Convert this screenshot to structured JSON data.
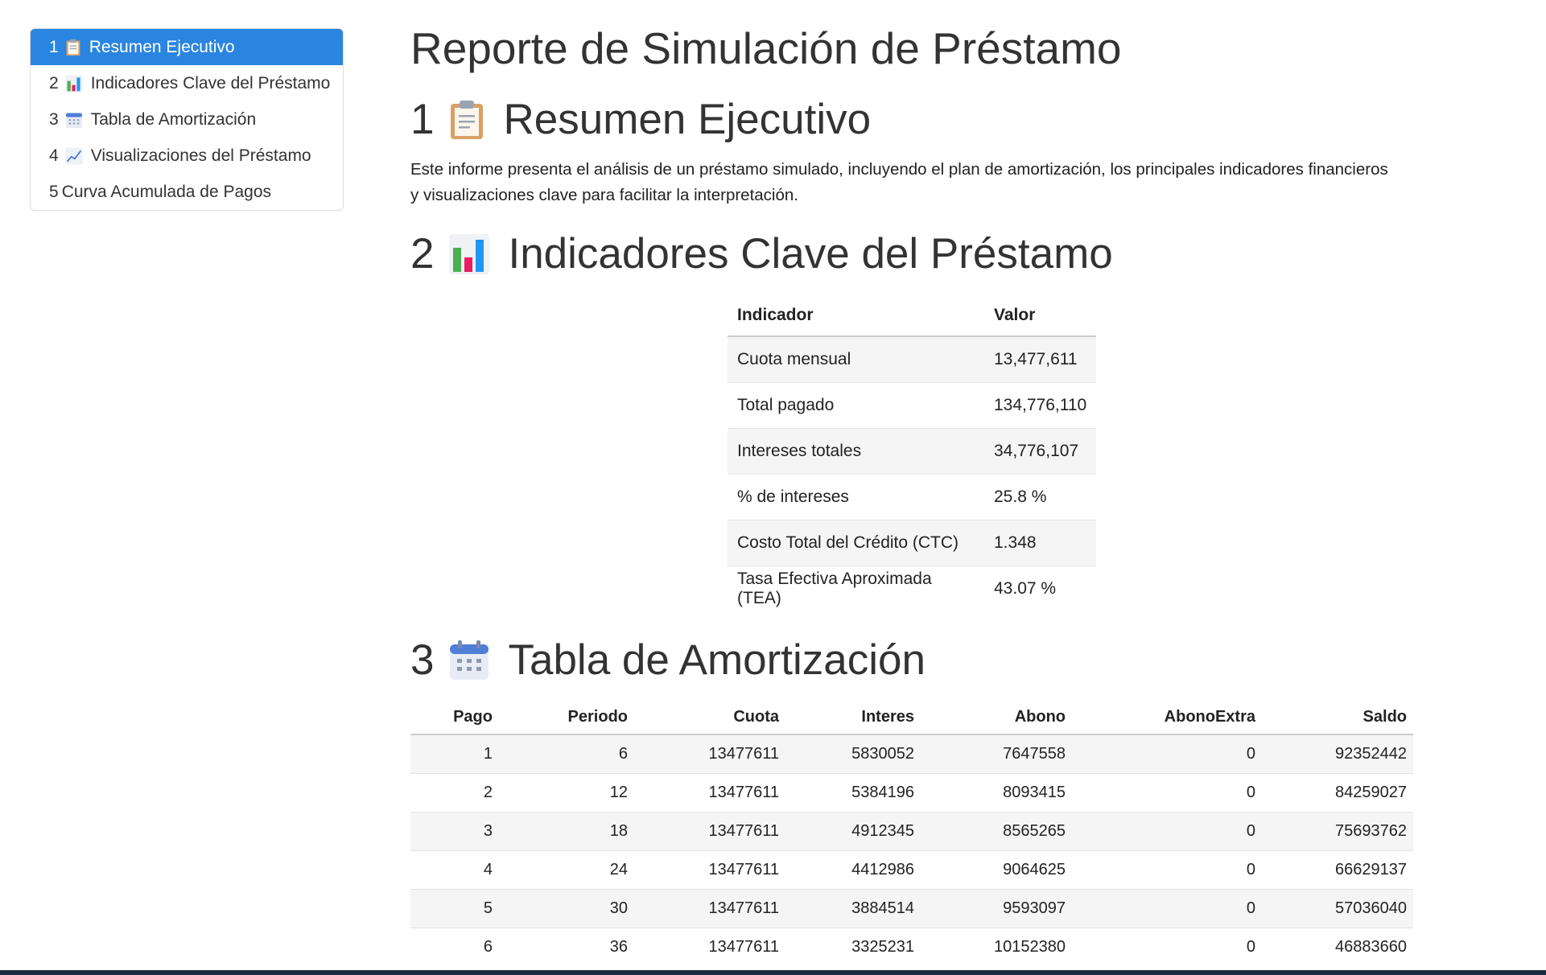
{
  "toc": [
    {
      "num": "1",
      "icon": "clipboard-icon",
      "label": "Resumen Ejecutivo",
      "active": true
    },
    {
      "num": "2",
      "icon": "bar-chart-icon",
      "label": "Indicadores Clave del Préstamo"
    },
    {
      "num": "3",
      "icon": "calendar-icon",
      "label": "Tabla de Amortización"
    },
    {
      "num": "4",
      "icon": "line-chart-icon",
      "label": "Visualizaciones del Préstamo"
    },
    {
      "num": "5",
      "icon": "",
      "label": "Curva Acumulada de Pagos"
    }
  ],
  "title": "Reporte de Simulación de Préstamo",
  "sections": {
    "s1": {
      "num": "1",
      "icon": "clipboard-icon",
      "title": "Resumen Ejecutivo"
    },
    "s2": {
      "num": "2",
      "icon": "bar-chart-icon",
      "title": "Indicadores Clave del Préstamo"
    },
    "s3": {
      "num": "3",
      "icon": "calendar-icon",
      "title": "Tabla de Amortización"
    }
  },
  "summary": "Este informe presenta el análisis de un préstamo simulado, incluyendo el plan de amortización, los principales indicadores financieros y visualizaciones clave para facilitar la interpretación.",
  "indicators": {
    "headers": [
      "Indicador",
      "Valor"
    ],
    "rows": [
      [
        "Cuota mensual",
        "13,477,611"
      ],
      [
        "Total pagado",
        "134,776,110"
      ],
      [
        "Intereses totales",
        "34,776,107"
      ],
      [
        "% de intereses",
        "25.8 %"
      ],
      [
        "Costo Total del Crédito (CTC)",
        "1.348"
      ],
      [
        "Tasa Efectiva Aproximada (TEA)",
        "43.07 %"
      ]
    ]
  },
  "amortization": {
    "headers": [
      "Pago",
      "Periodo",
      "Cuota",
      "Interes",
      "Abono",
      "AbonoExtra",
      "Saldo"
    ],
    "rows": [
      [
        "1",
        "6",
        "13477611",
        "5830052",
        "7647558",
        "0",
        "92352442"
      ],
      [
        "2",
        "12",
        "13477611",
        "5384196",
        "8093415",
        "0",
        "84259027"
      ],
      [
        "3",
        "18",
        "13477611",
        "4912345",
        "8565265",
        "0",
        "75693762"
      ],
      [
        "4",
        "24",
        "13477611",
        "4412986",
        "9064625",
        "0",
        "66629137"
      ],
      [
        "5",
        "30",
        "13477611",
        "3884514",
        "9593097",
        "0",
        "57036040"
      ],
      [
        "6",
        "36",
        "13477611",
        "3325231",
        "10152380",
        "0",
        "46883660"
      ]
    ]
  }
}
